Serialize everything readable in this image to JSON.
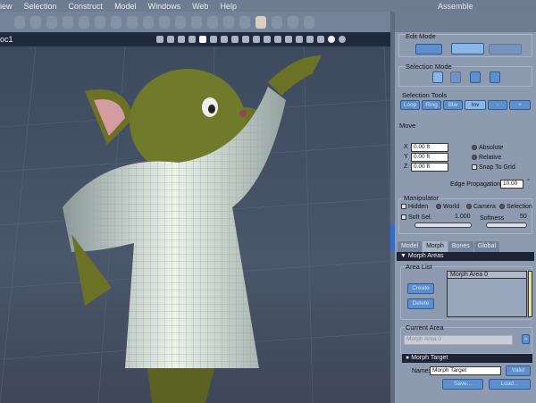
{
  "menu": {
    "items": [
      "iew",
      "Selection",
      "Construct",
      "Model",
      "Windows",
      "Web",
      "Help"
    ],
    "mode": "Assemble"
  },
  "viewport": {
    "title": "oc1"
  },
  "panel": {
    "edit_mode": {
      "label": "Edit Mode"
    },
    "selection_mode": {
      "label": "Selection Mode"
    },
    "selection_tools": {
      "label": "Selection Tools",
      "buttons": [
        "Loop",
        "Ring",
        "Btw",
        "Inv",
        "-",
        "+"
      ]
    },
    "move": {
      "label": "Move",
      "x_label": "X",
      "x": "0.00 ft",
      "y_label": "Y",
      "y": "0.00 ft",
      "z_label": "Z",
      "z": "0.00 ft",
      "absolute": "Absolute",
      "relative": "Relative",
      "snap": "Snap To Grid",
      "edge_prop_label": "Edge Propagation",
      "edge_prop": "10.00",
      "edge_unit": "°"
    },
    "manipulator": {
      "label": "Manipulator",
      "hidden": "Hidden",
      "world": "World",
      "camera": "Camera",
      "selection": "Selection",
      "soft_sel": "Soft Sel.",
      "soft_sel_value": "1.000",
      "softness": "Softness",
      "softness_value": "50"
    },
    "tabs": [
      "Model",
      "Morph",
      "Bones",
      "Global"
    ],
    "active_tab": "Morph",
    "morph_areas": {
      "header": "Morph Areas",
      "area_list": "Area List",
      "create": "Create",
      "delete": "Delete",
      "items": [
        "Morph Area 0"
      ]
    },
    "current_area": {
      "label": "Current Area",
      "value": "Morph Area 0"
    },
    "morph_target": {
      "header": "Morph Target",
      "name_label": "Name:",
      "name": "Morph Target",
      "valid": "Valid",
      "save": "Save...",
      "load": "Load..."
    }
  }
}
